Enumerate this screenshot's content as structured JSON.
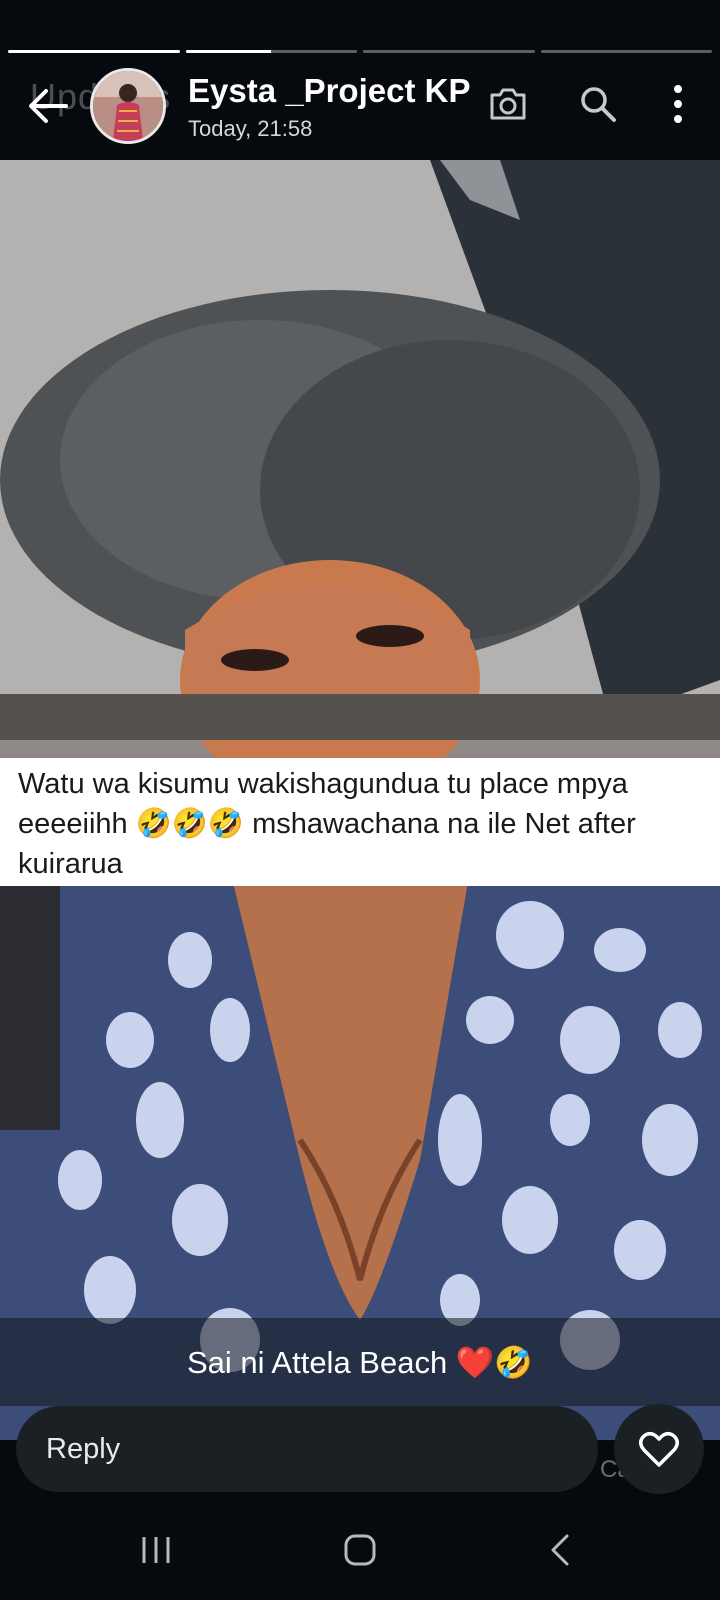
{
  "progress": [
    {
      "state": "viewed",
      "fill": 1.0
    },
    {
      "state": "current",
      "fill": 0.5
    },
    {
      "state": "upcoming",
      "fill": 0.0
    },
    {
      "state": "upcoming",
      "fill": 0.0
    }
  ],
  "header": {
    "back_icon": "arrow-left-icon",
    "ghost_text": "Updates",
    "contact_name": "Eysta _Project KP",
    "timestamp": "Today, 21:58",
    "actions": [
      "camera-icon",
      "search-icon",
      "more-vert-icon"
    ]
  },
  "status": {
    "caption_overlay": "Watu wa kisumu wakishagundua tu place mpya eeeeiihh 🤣🤣🤣 mshawachana na ile Net after kuirarua",
    "bottom_caption": "Sai ni Attela Beach ❤️🤣"
  },
  "reply": {
    "placeholder": "Reply",
    "ghost_text": "Ca",
    "heart_icon": "heart-outline-icon"
  },
  "navbar": [
    "recent-apps-icon",
    "home-icon",
    "back-icon"
  ],
  "colors": {
    "background": "#06090e",
    "pill": "#1b2025",
    "dress_blue": "#3b4d78",
    "dots": "#c9d3ee"
  }
}
